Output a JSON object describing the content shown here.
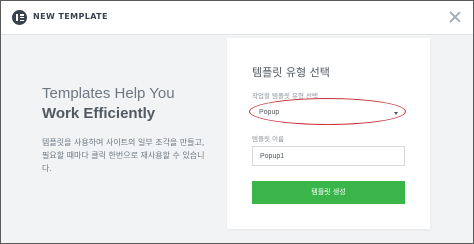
{
  "header": {
    "title": "NEW TEMPLATE",
    "logo_icon": "elementor-logo-icon",
    "close_icon": "close-icon"
  },
  "intro": {
    "line1": "Templates Help You",
    "line2": "Work Efficiently",
    "description": "템플릿을 사용하여 사이트의 일부 조각을 만들고, 필요할 때마다 클릭 한번으로 재사용할 수 있습니다."
  },
  "form": {
    "title": "템플릿 유형 선택",
    "type_label": "작업할 템플릿 유형 선택",
    "type_selected": "Popup",
    "name_label": "템플릿 이름",
    "name_value": "Popup1",
    "submit_label": "템플릿 생성"
  },
  "colors": {
    "accent": "#39b54a",
    "highlight_oval": "#c8323a",
    "logo": "#39414d"
  }
}
